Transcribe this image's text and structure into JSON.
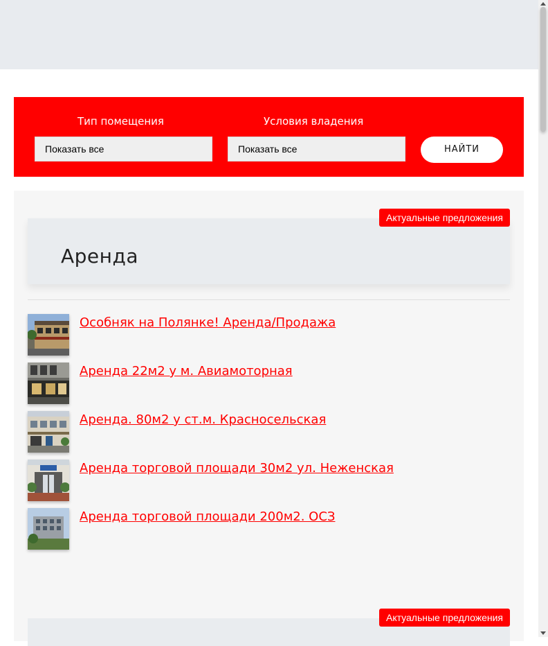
{
  "filters": {
    "type_label": "Тип помещения",
    "type_value": "Показать все",
    "ownership_label": "Условия владения",
    "ownership_value": "Показать все",
    "search_label": "НАЙТИ"
  },
  "sections": [
    {
      "badge": "Актуальные предложения",
      "title": "Аренда",
      "offers": [
        {
          "title": "Особняк на Полянке! Аренда/Продажа"
        },
        {
          "title": "Аренда 22м2 у м. Авиамоторная"
        },
        {
          "title": "Аренда. 80м2 у ст.м. Красносельская"
        },
        {
          "title": "Аренда торговой площади 30м2 ул. Неженская"
        },
        {
          "title": "Аренда торговой площади 200м2. ОСЗ"
        }
      ]
    },
    {
      "badge": "Актуальные предложения"
    }
  ],
  "colors": {
    "accent": "#ff0000",
    "panel": "#f6f6f6",
    "header_bg": "#e9ecef"
  }
}
